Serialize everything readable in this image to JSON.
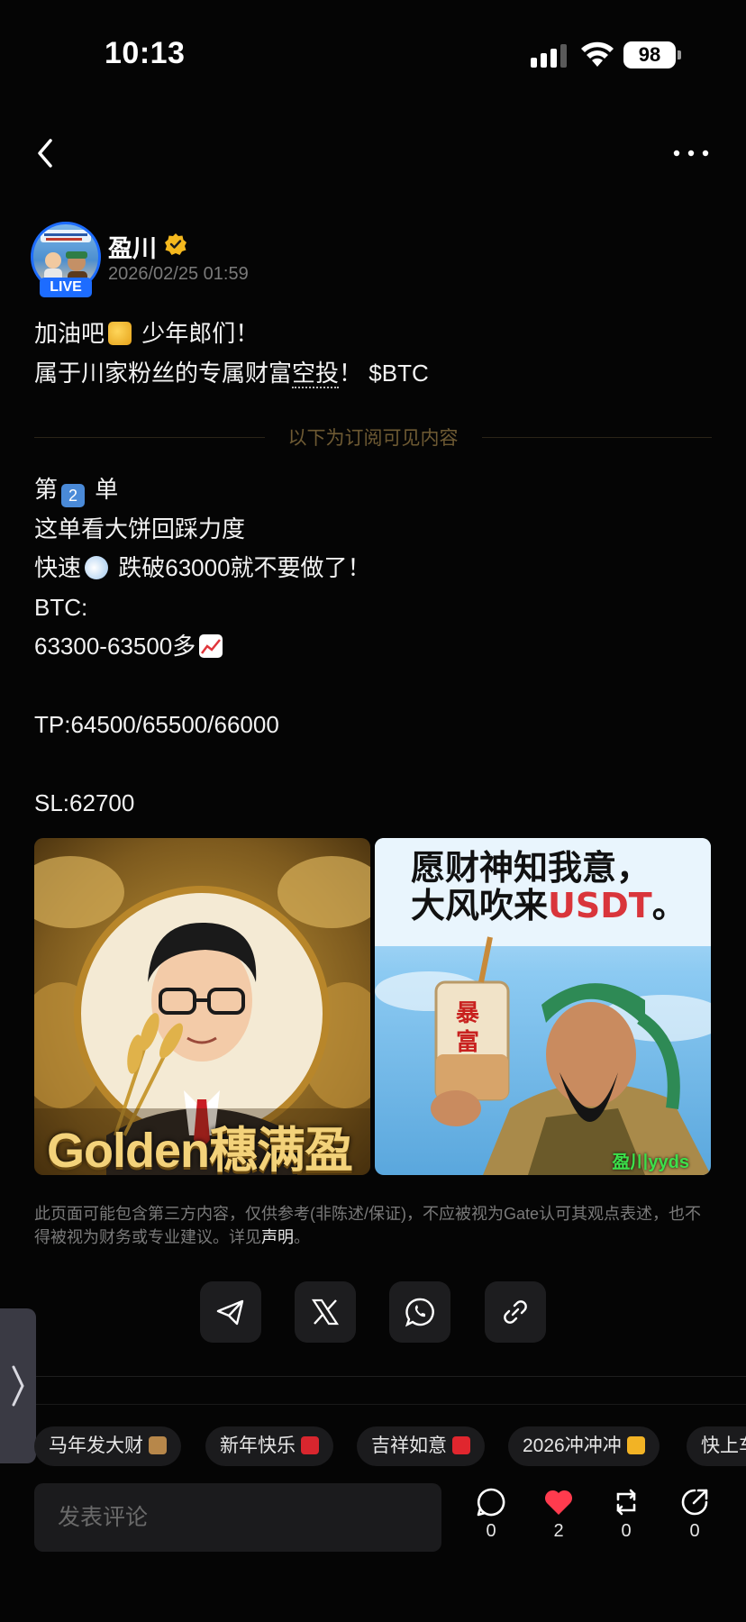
{
  "status_bar": {
    "time": "10:13",
    "battery": "98"
  },
  "nav": {
    "back_icon": "chevron-left-icon",
    "more_icon": "more-horizontal-icon"
  },
  "author": {
    "name": "盈川",
    "badge_text": "LIVE",
    "timestamp": "2026/02/25 01:59",
    "verified_icon": "verified-badge-icon"
  },
  "post": {
    "intro_line1_a": "加油吧",
    "intro_line1_b": " 少年郎们！",
    "intro_line2_a": "属于川家粉丝的专属财富",
    "intro_line2_dotted": "空投",
    "intro_line2_b": "！ ",
    "intro_ticker": "$BTC",
    "subscriber_divider": "以下为订阅可见内容",
    "body_line1_a": "第",
    "body_line1_b": " 单",
    "body_line2": "这单看大饼回踩力度",
    "body_line3_a": "快速",
    "body_line3_b": " 跌破63000就不要做了！",
    "body_line4": "BTC:",
    "body_line5": "63300-63500多",
    "body_line6": "TP:64500/65500/66000",
    "body_line7": "SL:62700"
  },
  "images": {
    "left_caption": "Golden穗满盈",
    "right_caption_line1": "愿财神知我意，",
    "right_caption_line2_a": "大风吹来",
    "right_caption_line2_b": "USDT",
    "right_caption_line2_c": "。",
    "right_cup_text": "暴富",
    "right_watermark": "盈川yyds"
  },
  "disclaimer": {
    "text": "此页面可能包含第三方内容，仅供参考(非陈述/保证)，不应被视为Gate认可其观点表述，也不得被视为财务或专业建议。详见",
    "link": "声明",
    "end": "。"
  },
  "share_buttons": [
    {
      "icon": "telegram-icon"
    },
    {
      "icon": "x-icon"
    },
    {
      "icon": "whatsapp-icon"
    },
    {
      "icon": "link-icon"
    }
  ],
  "tags": [
    "马年发大财",
    "新年快乐",
    "吉祥如意",
    "2026冲冲冲",
    "快上车"
  ],
  "comment": {
    "placeholder": "发表评论"
  },
  "actions": {
    "comment_count": "0",
    "like_count": "2",
    "repost_count": "0",
    "share_count": "0"
  },
  "colors": {
    "accent_blue": "#1d6cff",
    "like_red": "#ff3b4e",
    "divider_text": "#6e5a33"
  }
}
